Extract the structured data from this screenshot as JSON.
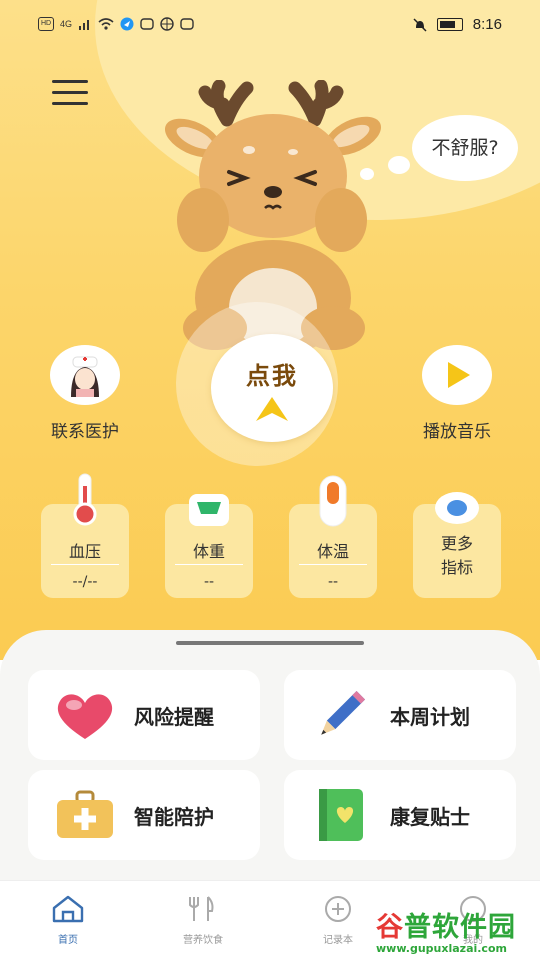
{
  "status_bar": {
    "left_icons": [
      "hd-icon",
      "signal-4g-icon",
      "signal-bars-icon",
      "wifi-icon",
      "location-icon",
      "app-icon-1",
      "app-icon-2",
      "app-icon-3"
    ],
    "hd_label": "HD",
    "net_label": "4G",
    "time": "8:16"
  },
  "hero": {
    "bubble_text": "不舒服?",
    "tap_me_label": "点我",
    "contact_care_label": "联系医护",
    "play_music_label": "播放音乐"
  },
  "metrics": [
    {
      "label": "血压",
      "value": "--/--",
      "icon": "thermometer-icon"
    },
    {
      "label": "体重",
      "value": "--",
      "icon": "scale-icon"
    },
    {
      "label": "体温",
      "value": "--",
      "icon": "temperature-icon"
    },
    {
      "label": "更多\n指标",
      "value": "",
      "icon": "more-indicators-icon"
    }
  ],
  "more_metrics": {
    "line1": "更多",
    "line2": "指标"
  },
  "features": {
    "risk_alert": "风险提醒",
    "weekly_plan": "本周计划",
    "smart_care": "智能陪护",
    "rehab_tips": "康复贴士"
  },
  "tabs": [
    {
      "label": "首页",
      "icon": "home-icon",
      "active": true
    },
    {
      "label": "营养饮食",
      "icon": "fork-knife-icon",
      "active": false
    },
    {
      "label": "记录本",
      "icon": "add-record-icon",
      "active": false
    },
    {
      "label": "我的",
      "icon": "profile-icon",
      "active": false
    }
  ],
  "watermark": {
    "text_a": "谷",
    "text_b": "普软件园",
    "url": "www.gupuxlazai.com"
  },
  "colors": {
    "hero_top": "#fde08a",
    "hero_bottom": "#fbcb52",
    "accent": "#f5c518",
    "tab_active": "#3a6fb0"
  }
}
